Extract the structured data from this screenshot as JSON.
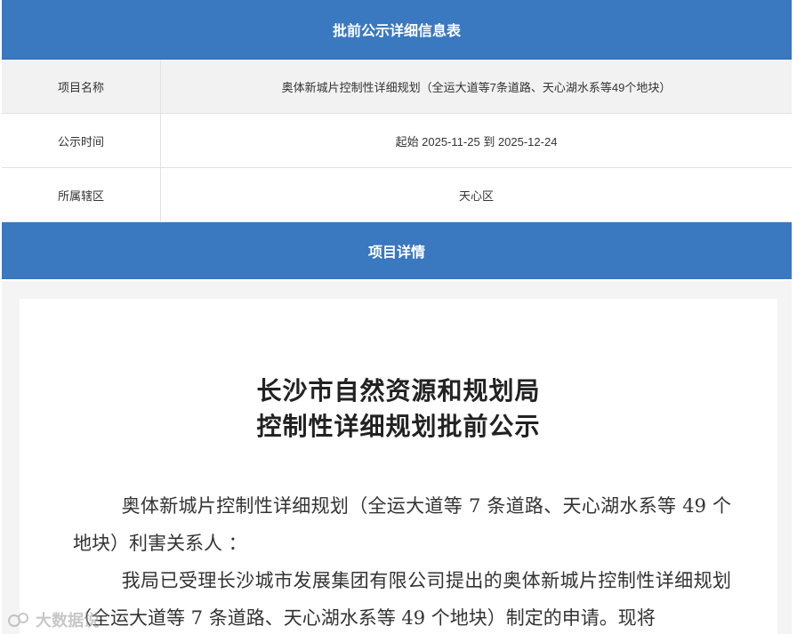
{
  "info": {
    "header": "批前公示详细信息表",
    "rows": [
      {
        "label": "项目名称",
        "value": "奥体新城片控制性详细规划（全运大道等7条道路、天心湖水系等49个地块）"
      },
      {
        "label": "公示时间",
        "value": "起始 2025-11-25 到 2025-12-24"
      },
      {
        "label": "所属辖区",
        "value": "天心区"
      }
    ]
  },
  "details": {
    "header": "项目详情"
  },
  "document": {
    "title_line1": "长沙市自然资源和规划局",
    "title_line2": "控制性详细规划批前公示",
    "paragraph1": "奥体新城片控制性详细规划（全运大道等 7 条道路、天心湖水系等 49 个地块）利害关系人 ：",
    "paragraph2": "我局已受理长沙城市发展集团有限公司提出的奥体新城片控制性详细规划（全运大道等 7 条道路、天心湖水系等 49 个地块）制定的申请。现将"
  },
  "watermark": {
    "text": "大数据说"
  }
}
